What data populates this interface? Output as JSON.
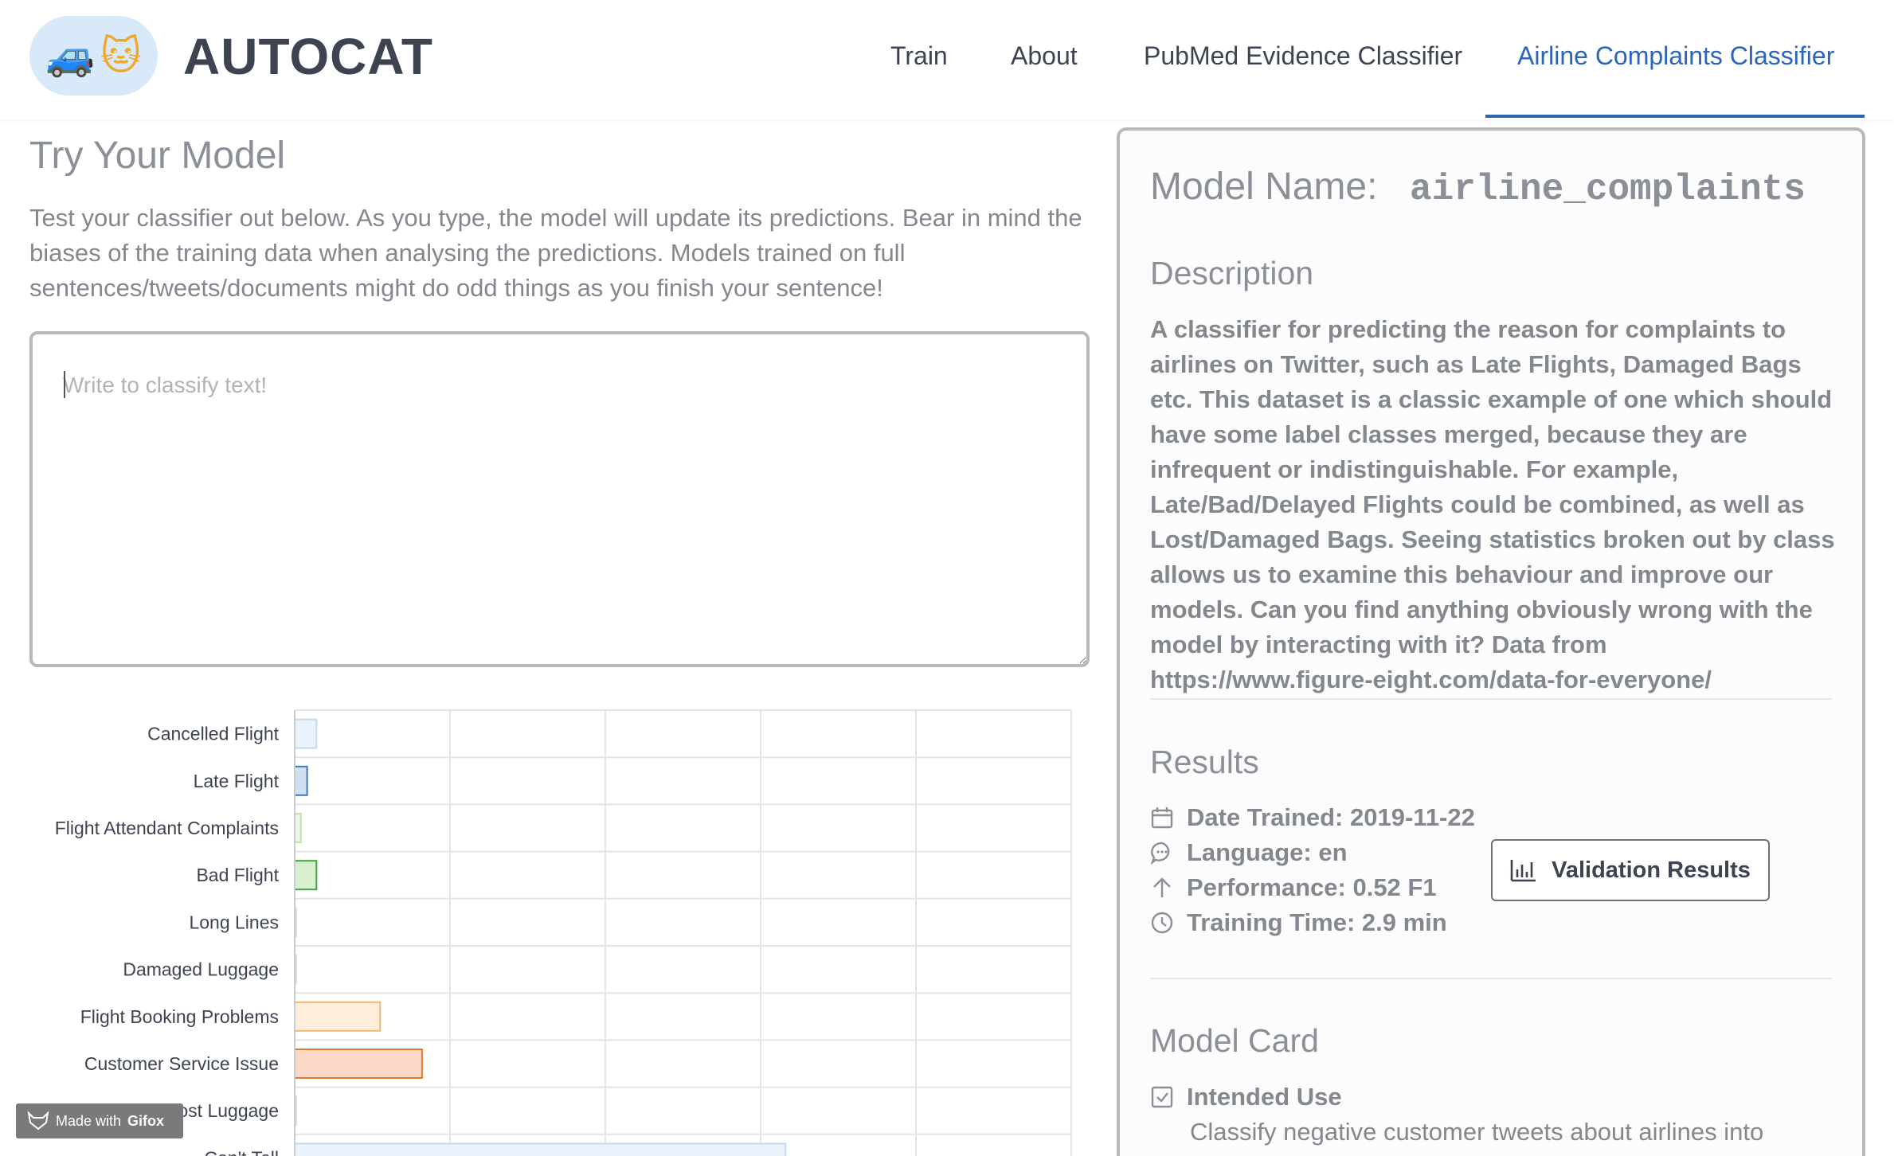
{
  "header": {
    "logo_car": "🚙",
    "logo_cat": "🐱",
    "brand": "AUTOCAT",
    "nav": [
      {
        "label": "Train"
      },
      {
        "label": "About"
      },
      {
        "label": "PubMed Evidence Classifier"
      },
      {
        "label": "Airline Complaints Classifier",
        "active": true
      }
    ],
    "accent_color": "#2c64b8"
  },
  "try_model": {
    "title": "Try Your Model",
    "intro": "Test your classifier out below. As you type, the model will update its predictions. Bear in mind the biases of the training data when analysing the predictions. Models trained on full sentences/tweets/documents might do odd things as you finish your sentence!",
    "input_placeholder": "Write to classify text!",
    "input_value": ""
  },
  "chart_data": {
    "type": "bar",
    "orientation": "horizontal",
    "categories": [
      "Cancelled Flight",
      "Late Flight",
      "Flight Attendant Complaints",
      "Bad Flight",
      "Long Lines",
      "Damaged Luggage",
      "Flight Booking Problems",
      "Customer Service Issue",
      "Lost Luggage",
      "Can't Tell"
    ],
    "values": [
      0.014,
      0.008,
      0.004,
      0.014,
      0.001,
      0.001,
      0.055,
      0.082,
      0.001,
      0.316
    ],
    "colors": [
      "#eaf2fb",
      "#cfe0f1",
      "#eef8e6",
      "#d9efcf",
      "#ffffff",
      "#ffffff",
      "#fdeedc",
      "#fcd9c6",
      "#ffffff",
      "#eaf2fb"
    ],
    "border_colors": [
      "#c6d9ee",
      "#3f7ab8",
      "#bfe3a8",
      "#3fa53f",
      "#dddddd",
      "#dddddd",
      "#f0b872",
      "#e5782b",
      "#dddddd",
      "#c6d9ee"
    ],
    "xlim": [
      0,
      0.5
    ],
    "grid": true,
    "legend": "none"
  },
  "gifox": {
    "prefix": "Made with",
    "brand": "Gifox"
  },
  "model_card": {
    "name_label": "Model Name:",
    "name_value": "airline_complaints",
    "description_heading": "Description",
    "description": "A classifier for predicting the reason for complaints to airlines on Twitter, such as Late Flights, Damaged Bags etc. This dataset is a classic example of one which should have some label classes merged, because they are infrequent or indistinguishable. For example, Late/Bad/Delayed Flights could be combined, as well as Lost/Damaged Bags. Seeing statistics broken out by class allows us to examine this behaviour and improve our models. Can you find anything obviously wrong with the model by interacting with it? Data from https://www.figure-eight.com/data-for-everyone/",
    "results_heading": "Results",
    "results": [
      {
        "icon": "calendar-icon",
        "text": "Date Trained: 2019-11-22"
      },
      {
        "icon": "chat-bubble-icon",
        "text": "Language: en"
      },
      {
        "icon": "arrow-up-icon",
        "text": "Performance: 0.52 F1"
      },
      {
        "icon": "clock-icon",
        "text": "Training Time: 2.9 min"
      }
    ],
    "validation_button": "Validation Results",
    "card_heading": "Model Card",
    "intended_use_label": "Intended Use",
    "intended_use_text": "Classify negative customer tweets about airlines into"
  }
}
